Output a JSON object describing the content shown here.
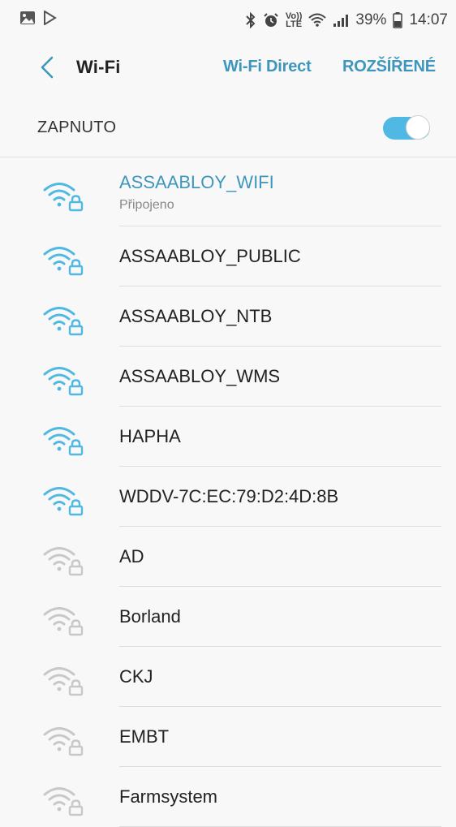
{
  "status_bar": {
    "volte": "Vo))",
    "lte": "LTE",
    "battery_percent": "39%",
    "time": "14:07"
  },
  "header": {
    "title": "Wi-Fi",
    "wifi_direct": "Wi-Fi Direct",
    "advanced": "ROZŠÍŘENÉ"
  },
  "toggle": {
    "label": "ZAPNUTO",
    "on": true
  },
  "networks": [
    {
      "name": "ASSAABLOY_WIFI",
      "status": "Připojeno",
      "connected": true,
      "strength": "full",
      "secured": true
    },
    {
      "name": "ASSAABLOY_PUBLIC",
      "strength": "full",
      "secured": true
    },
    {
      "name": "ASSAABLOY_NTB",
      "strength": "full",
      "secured": true
    },
    {
      "name": "ASSAABLOY_WMS",
      "strength": "full",
      "secured": true
    },
    {
      "name": "HAPHA",
      "strength": "full",
      "secured": true
    },
    {
      "name": "WDDV-7C:EC:79:D2:4D:8B",
      "strength": "full",
      "secured": true
    },
    {
      "name": "AD",
      "strength": "weak",
      "secured": true
    },
    {
      "name": "Borland",
      "strength": "weak",
      "secured": true
    },
    {
      "name": "CKJ",
      "strength": "weak",
      "secured": true
    },
    {
      "name": "EMBT",
      "strength": "weak",
      "secured": true
    },
    {
      "name": "Farmsystem",
      "strength": "weak",
      "secured": true
    }
  ],
  "colors": {
    "accent": "#3f96bd",
    "switch_on": "#4fb9e3",
    "wifi_strong": "#4fb9e3",
    "wifi_weak": "#c8c8c8"
  }
}
